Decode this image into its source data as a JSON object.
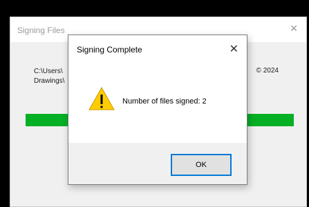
{
  "parent_window": {
    "title": "Signing Files",
    "close_glyph": "✕",
    "path_text": "C:\\Users\\\nDrawings\\",
    "right_text": "© 2024",
    "progress": 1.0,
    "progress_color": "#06b025"
  },
  "dialog": {
    "title": "Signing Complete",
    "close_glyph": "✕",
    "icon": "warning-icon",
    "message": "Number of files signed: 2",
    "ok_label": "OK",
    "accent_color": "#0078d7"
  }
}
